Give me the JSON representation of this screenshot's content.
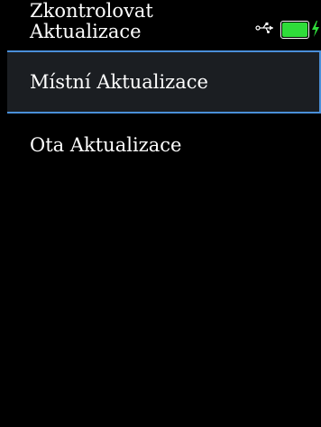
{
  "header": {
    "title": "Zkontrolovat Aktualizace",
    "icons": {
      "usb": "usb-icon",
      "battery": "battery-icon",
      "charging": "charging-bolt-icon"
    },
    "battery_level": 1.0,
    "battery_color": "#2fdc3a"
  },
  "menu": {
    "items": [
      {
        "label": "Místní Aktualizace",
        "selected": true
      },
      {
        "label": "Ota Aktualizace",
        "selected": false
      }
    ]
  },
  "colors": {
    "background": "#000000",
    "selected_bg": "#1b1e22",
    "selected_border": "#4a8fd8",
    "text": "#ffffff"
  }
}
